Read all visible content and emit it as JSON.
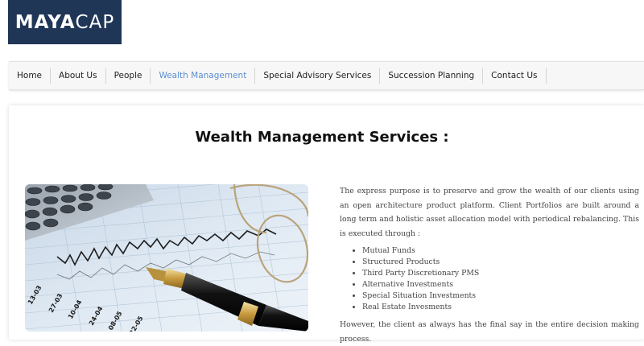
{
  "logo": {
    "part1": "MAYA",
    "part2": "CAP"
  },
  "nav": {
    "items": [
      "Home",
      "About Us",
      "People",
      "Wealth Management",
      "Special Advisory Services",
      "Succession Planning",
      "Contact Us"
    ],
    "active": "Wealth Management"
  },
  "page": {
    "title": "Wealth Management Services :",
    "intro": "The express purpose is to preserve and grow the wealth of our clients using an open architecture product platform. Client Portfolios are built around a long term and holistic asset allocation model with periodical rebalancing. This is executed through :",
    "services": [
      "Mutual Funds",
      "Structured Products",
      "Third Party Discretionary PMS",
      "Alternative Investments",
      "Special Situation Investments",
      "Real Estate Invesments"
    ],
    "closing": "However, the client as always has the final say in the entire decision making process."
  },
  "photo": {
    "dates": [
      "13-03",
      "27-03",
      "10-04",
      "24-04",
      "08-05",
      "22-05"
    ]
  },
  "colors": {
    "brand": "#1f3657",
    "active_nav": "#5b8ed1"
  }
}
